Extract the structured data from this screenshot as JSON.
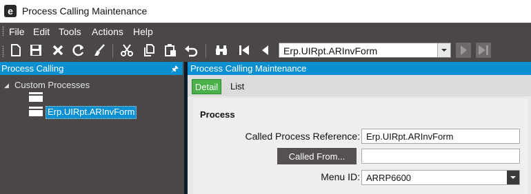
{
  "window": {
    "title": "Process Calling Maintenance",
    "logo_letter": "e"
  },
  "menu": {
    "items": [
      "File",
      "Edit",
      "Tools",
      "Actions",
      "Help"
    ]
  },
  "toolbar": {
    "icons": [
      "new-icon",
      "save-icon",
      "delete-icon",
      "refresh-icon",
      "clear-icon",
      "cut-icon",
      "copy-icon",
      "paste-icon",
      "undo-icon",
      "search-icon",
      "first-record-icon",
      "previous-record-icon",
      "next-record-icon",
      "last-record-icon"
    ],
    "record_selector": "Erp.UIRpt.ARInvForm"
  },
  "left_panel": {
    "title": "Process Calling",
    "tree": {
      "root_label": "Custom Processes",
      "selected_label": "Erp.UIRpt.ARInvForm"
    }
  },
  "right_panel": {
    "title": "Process Calling Maintenance",
    "tabs": [
      "Detail",
      "List"
    ],
    "group_title": "Process",
    "fields": {
      "called_process_reference": {
        "label": "Called Process Reference:",
        "value": "Erp.UIRpt.ARInvForm"
      },
      "called_from": {
        "button_label": "Called From...",
        "value": ""
      },
      "menu_id": {
        "label": "Menu ID:",
        "value": "ARRP6600"
      }
    }
  },
  "colors": {
    "accent": "#0a8fd1",
    "active_tab": "#4ab14a",
    "chrome": "#4a4746"
  }
}
